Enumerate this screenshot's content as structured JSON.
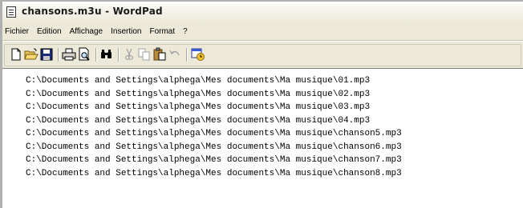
{
  "window": {
    "title": "chansons.m3u - WordPad"
  },
  "menubar": {
    "items": [
      "Fichier",
      "Edition",
      "Affichage",
      "Insertion",
      "Format",
      "?"
    ]
  },
  "toolbar": {
    "icons": [
      "new-document-icon",
      "open-folder-icon",
      "save-icon",
      "print-icon",
      "print-preview-icon",
      "find-icon",
      "cut-icon",
      "copy-icon",
      "paste-icon",
      "undo-icon",
      "insert-date-time-icon"
    ]
  },
  "document": {
    "lines": [
      "C:\\Documents and Settings\\alphega\\Mes documents\\Ma musique\\01.mp3",
      "C:\\Documents and Settings\\alphega\\Mes documents\\Ma musique\\02.mp3",
      "C:\\Documents and Settings\\alphega\\Mes documents\\Ma musique\\03.mp3",
      "C:\\Documents and Settings\\alphega\\Mes documents\\Ma musique\\04.mp3",
      "C:\\Documents and Settings\\alphega\\Mes documents\\Ma musique\\chanson5.mp3",
      "C:\\Documents and Settings\\alphega\\Mes documents\\Ma musique\\chanson6.mp3",
      "C:\\Documents and Settings\\alphega\\Mes documents\\Ma musique\\chanson7.mp3",
      "C:\\Documents and Settings\\alphega\\Mes documents\\Ma musique\\chanson8.mp3"
    ]
  }
}
